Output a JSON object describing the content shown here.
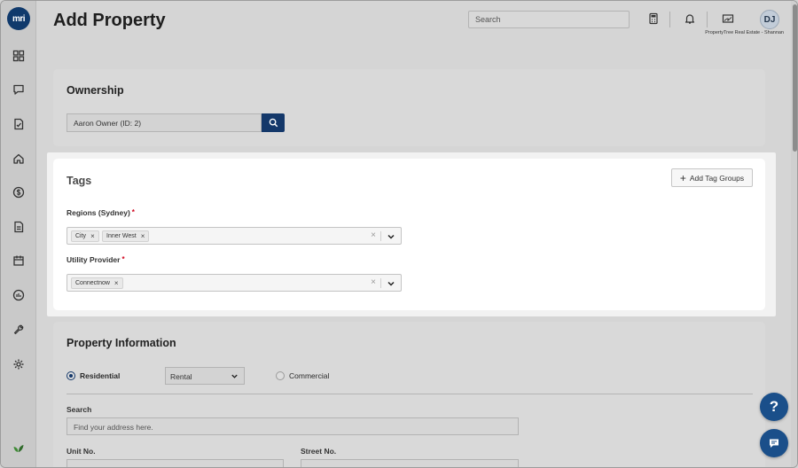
{
  "app": {
    "logo_text": "mri"
  },
  "header": {
    "title": "Add Property",
    "search_placeholder": "Search",
    "avatar_initials": "DJ",
    "company": "PropertyTree Real Estate - Shannan"
  },
  "sidebar": {
    "items": [
      {
        "icon": "dashboard-icon"
      },
      {
        "icon": "chat-icon"
      },
      {
        "icon": "tasks-icon"
      },
      {
        "icon": "home-icon"
      },
      {
        "icon": "dollar-icon"
      },
      {
        "icon": "document-icon"
      },
      {
        "icon": "calendar-icon"
      },
      {
        "icon": "metrics-icon"
      },
      {
        "icon": "wrench-icon"
      },
      {
        "icon": "settings-icon"
      }
    ]
  },
  "ownership": {
    "title": "Ownership",
    "value": "Aaron Owner (ID: 2)"
  },
  "tags": {
    "title": "Tags",
    "add_button": "Add Tag Groups",
    "regions_label": "Regions (Sydney)",
    "regions": [
      "City",
      "Inner West"
    ],
    "utility_label": "Utility Provider",
    "utility": [
      "Connectnow"
    ],
    "required_mark": "*",
    "chip_remove": "×",
    "clear": "×"
  },
  "property_info": {
    "title": "Property Information",
    "residential_label": "Residential",
    "residential_selected": true,
    "type_value": "Rental",
    "commercial_label": "Commercial",
    "search_label": "Search",
    "search_placeholder": "Find your address here.",
    "unit_label": "Unit No.",
    "street_no_label": "Street No."
  },
  "help": {
    "help_glyph": "?"
  },
  "colors": {
    "primary": "#14386a",
    "required": "#d0021b",
    "fab": "#1a4f8a"
  }
}
